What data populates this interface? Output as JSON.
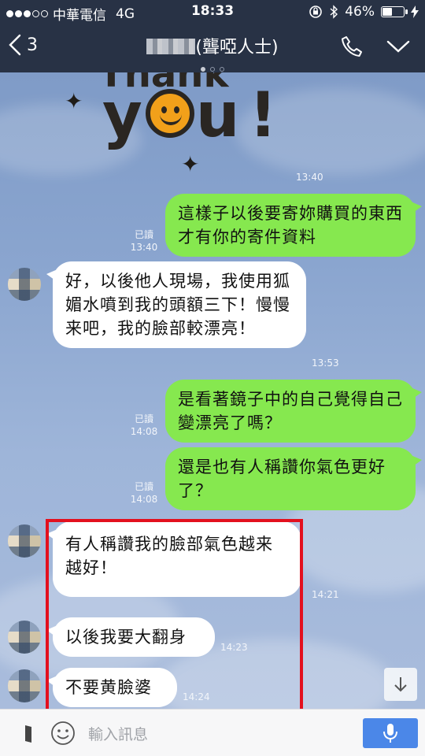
{
  "status_bar": {
    "carrier": "中華電信",
    "network": "4G",
    "time": "18:33",
    "battery_percent": "46%",
    "battery_level": 0.46,
    "signal_dots_filled": 3,
    "signal_dots_total": 5
  },
  "nav": {
    "back_count": "3",
    "title": "(聾啞人士)",
    "icons": [
      "back-chevron-icon",
      "phone-icon",
      "chevron-down-icon"
    ]
  },
  "sticker": {
    "top_text": "Thank",
    "main_text": "you!"
  },
  "messages": [
    {
      "id": "sticker",
      "time": "13:40"
    },
    {
      "id": "m1",
      "dir": "out",
      "text": "這樣子以後要寄妳購買的東西才有你的寄件資料",
      "read": "已讀",
      "time": "13:40"
    },
    {
      "id": "m2",
      "dir": "in",
      "text": "好，以後他人現場，我使用狐媚水噴到我的頭額三下！慢慢来吧，我的臉部較漂亮！",
      "time": "13:53"
    },
    {
      "id": "m3",
      "dir": "out",
      "text": "是看著鏡子中的自己覺得自己變漂亮了嗎？",
      "read": "已讀",
      "time": "14:08"
    },
    {
      "id": "m4",
      "dir": "out",
      "text": "還是也有人稱讚你氣色更好了？",
      "read": "已讀",
      "time": "14:08"
    },
    {
      "id": "m5",
      "dir": "in",
      "text": "有人稱讚我的臉部氣色越来越好！",
      "time": "14:21"
    },
    {
      "id": "m6",
      "dir": "in",
      "text": "以後我要大翻身",
      "time": "14:23"
    },
    {
      "id": "m7",
      "dir": "in",
      "text": "不要黄臉婆",
      "time": "14:24"
    }
  ],
  "input": {
    "placeholder": "輸入訊息"
  },
  "colors": {
    "header_bg": "#283245",
    "outgoing_bubble": "#86e84f",
    "incoming_bubble": "#ffffff",
    "highlight_border": "#e3101e",
    "mic_button": "#4b87e8"
  }
}
